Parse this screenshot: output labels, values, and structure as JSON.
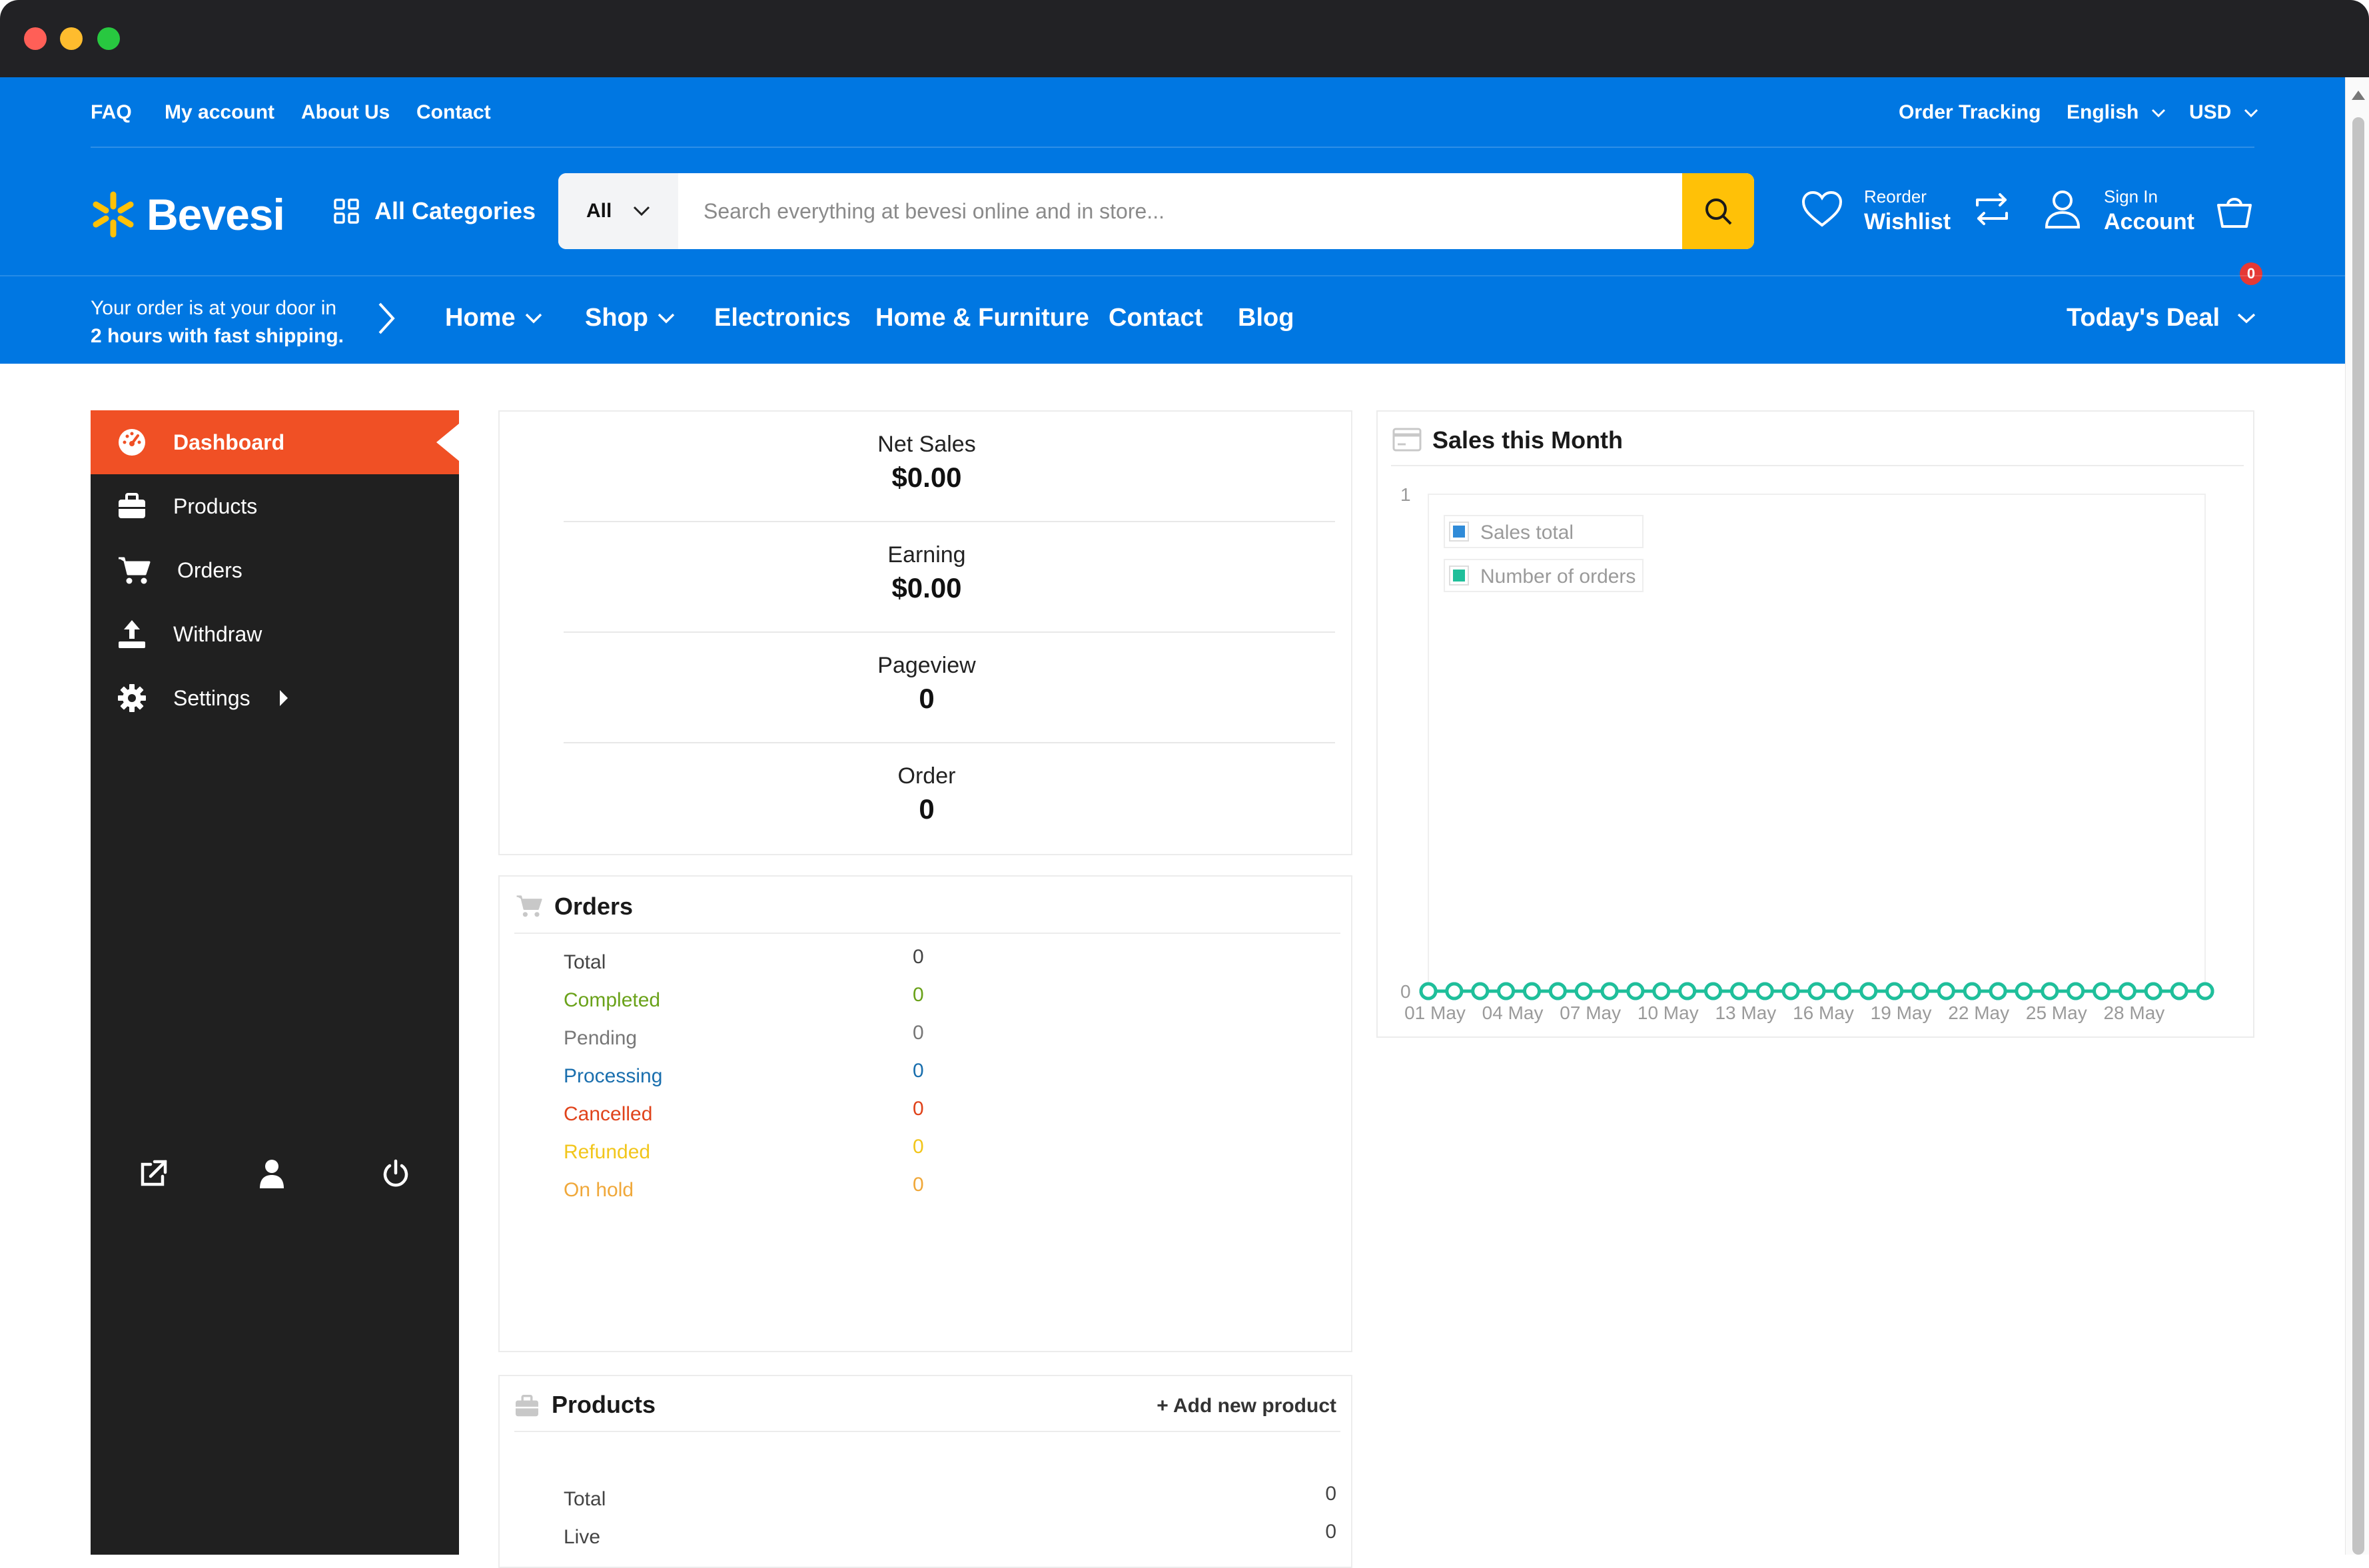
{
  "window": {
    "title": ""
  },
  "colors": {
    "brand_blue": "#0077e2",
    "accent_yellow": "#ffc107",
    "sidebar_bg": "#202020",
    "sidebar_active": "#f05025",
    "cart_badge": "#e53935"
  },
  "topbar": {
    "links": [
      "FAQ",
      "My account",
      "About Us",
      "Contact"
    ],
    "right": {
      "order_tracking": "Order Tracking",
      "language": "English",
      "currency": "USD"
    }
  },
  "header": {
    "logo": "Bevesi",
    "all_categories": "All Categories",
    "search": {
      "category": "All",
      "placeholder": "Search everything at bevesi online and in store..."
    },
    "wishlist": {
      "small": "Reorder",
      "big": "Wishlist"
    },
    "account": {
      "small": "Sign In",
      "big": "Account"
    },
    "cart_count": "0"
  },
  "nav": {
    "shipping_line1": "Your order is at your door in",
    "shipping_line2": "2 hours with fast shipping.",
    "items": [
      "Home",
      "Shop",
      "Electronics",
      "Home & Furniture",
      "Contact",
      "Blog"
    ],
    "todays_deal": "Today's Deal"
  },
  "sidebar": {
    "items": [
      {
        "label": "Dashboard",
        "icon": "dashboard-icon"
      },
      {
        "label": "Products",
        "icon": "briefcase-icon"
      },
      {
        "label": "Orders",
        "icon": "cart-icon"
      },
      {
        "label": "Withdraw",
        "icon": "upload-icon"
      },
      {
        "label": "Settings",
        "icon": "gear-icon"
      }
    ],
    "bottom_icons": [
      "external-link-icon",
      "user-icon",
      "power-icon"
    ]
  },
  "stats": [
    {
      "label": "Net Sales",
      "value": "$0.00"
    },
    {
      "label": "Earning",
      "value": "$0.00"
    },
    {
      "label": "Pageview",
      "value": "0"
    },
    {
      "label": "Order",
      "value": "0"
    }
  ],
  "orders": {
    "title": "Orders",
    "rows": [
      {
        "label": "Total",
        "value": "0",
        "color": "#444444"
      },
      {
        "label": "Completed",
        "value": "0",
        "color": "#6aa21a"
      },
      {
        "label": "Pending",
        "value": "0",
        "color": "#777777"
      },
      {
        "label": "Processing",
        "value": "0",
        "color": "#1a6fae"
      },
      {
        "label": "Cancelled",
        "value": "0",
        "color": "#e0431b"
      },
      {
        "label": "Refunded",
        "value": "0",
        "color": "#f2c61c"
      },
      {
        "label": "On hold",
        "value": "0",
        "color": "#f0a83a"
      }
    ]
  },
  "products": {
    "title": "Products",
    "add_link": "+ Add new product",
    "rows": [
      {
        "label": "Total",
        "value": "0"
      },
      {
        "label": "Live",
        "value": "0"
      }
    ]
  },
  "sales_chart": {
    "title": "Sales this Month"
  },
  "chart_data": {
    "type": "line",
    "title": "Sales this Month",
    "x": [
      "01 May",
      "02 May",
      "03 May",
      "04 May",
      "05 May",
      "06 May",
      "07 May",
      "08 May",
      "09 May",
      "10 May",
      "11 May",
      "12 May",
      "13 May",
      "14 May",
      "15 May",
      "16 May",
      "17 May",
      "18 May",
      "19 May",
      "20 May",
      "21 May",
      "22 May",
      "23 May",
      "24 May",
      "25 May",
      "26 May",
      "27 May",
      "28 May",
      "29 May",
      "30 May",
      "31 May"
    ],
    "tick_labels": [
      "01 May",
      "04 May",
      "07 May",
      "10 May",
      "13 May",
      "16 May",
      "19 May",
      "22 May",
      "25 May",
      "28 May"
    ],
    "series": [
      {
        "name": "Sales total",
        "color": "#2f8bd8",
        "values": [
          0,
          0,
          0,
          0,
          0,
          0,
          0,
          0,
          0,
          0,
          0,
          0,
          0,
          0,
          0,
          0,
          0,
          0,
          0,
          0,
          0,
          0,
          0,
          0,
          0,
          0,
          0,
          0,
          0,
          0,
          0
        ]
      },
      {
        "name": "Number of orders",
        "color": "#1fbf9a",
        "values": [
          0,
          0,
          0,
          0,
          0,
          0,
          0,
          0,
          0,
          0,
          0,
          0,
          0,
          0,
          0,
          0,
          0,
          0,
          0,
          0,
          0,
          0,
          0,
          0,
          0,
          0,
          0,
          0,
          0,
          0,
          0
        ]
      }
    ],
    "ylim": [
      0,
      1
    ],
    "y_ticks": [
      "0",
      "1"
    ],
    "legend": "top-left",
    "grid": false
  }
}
